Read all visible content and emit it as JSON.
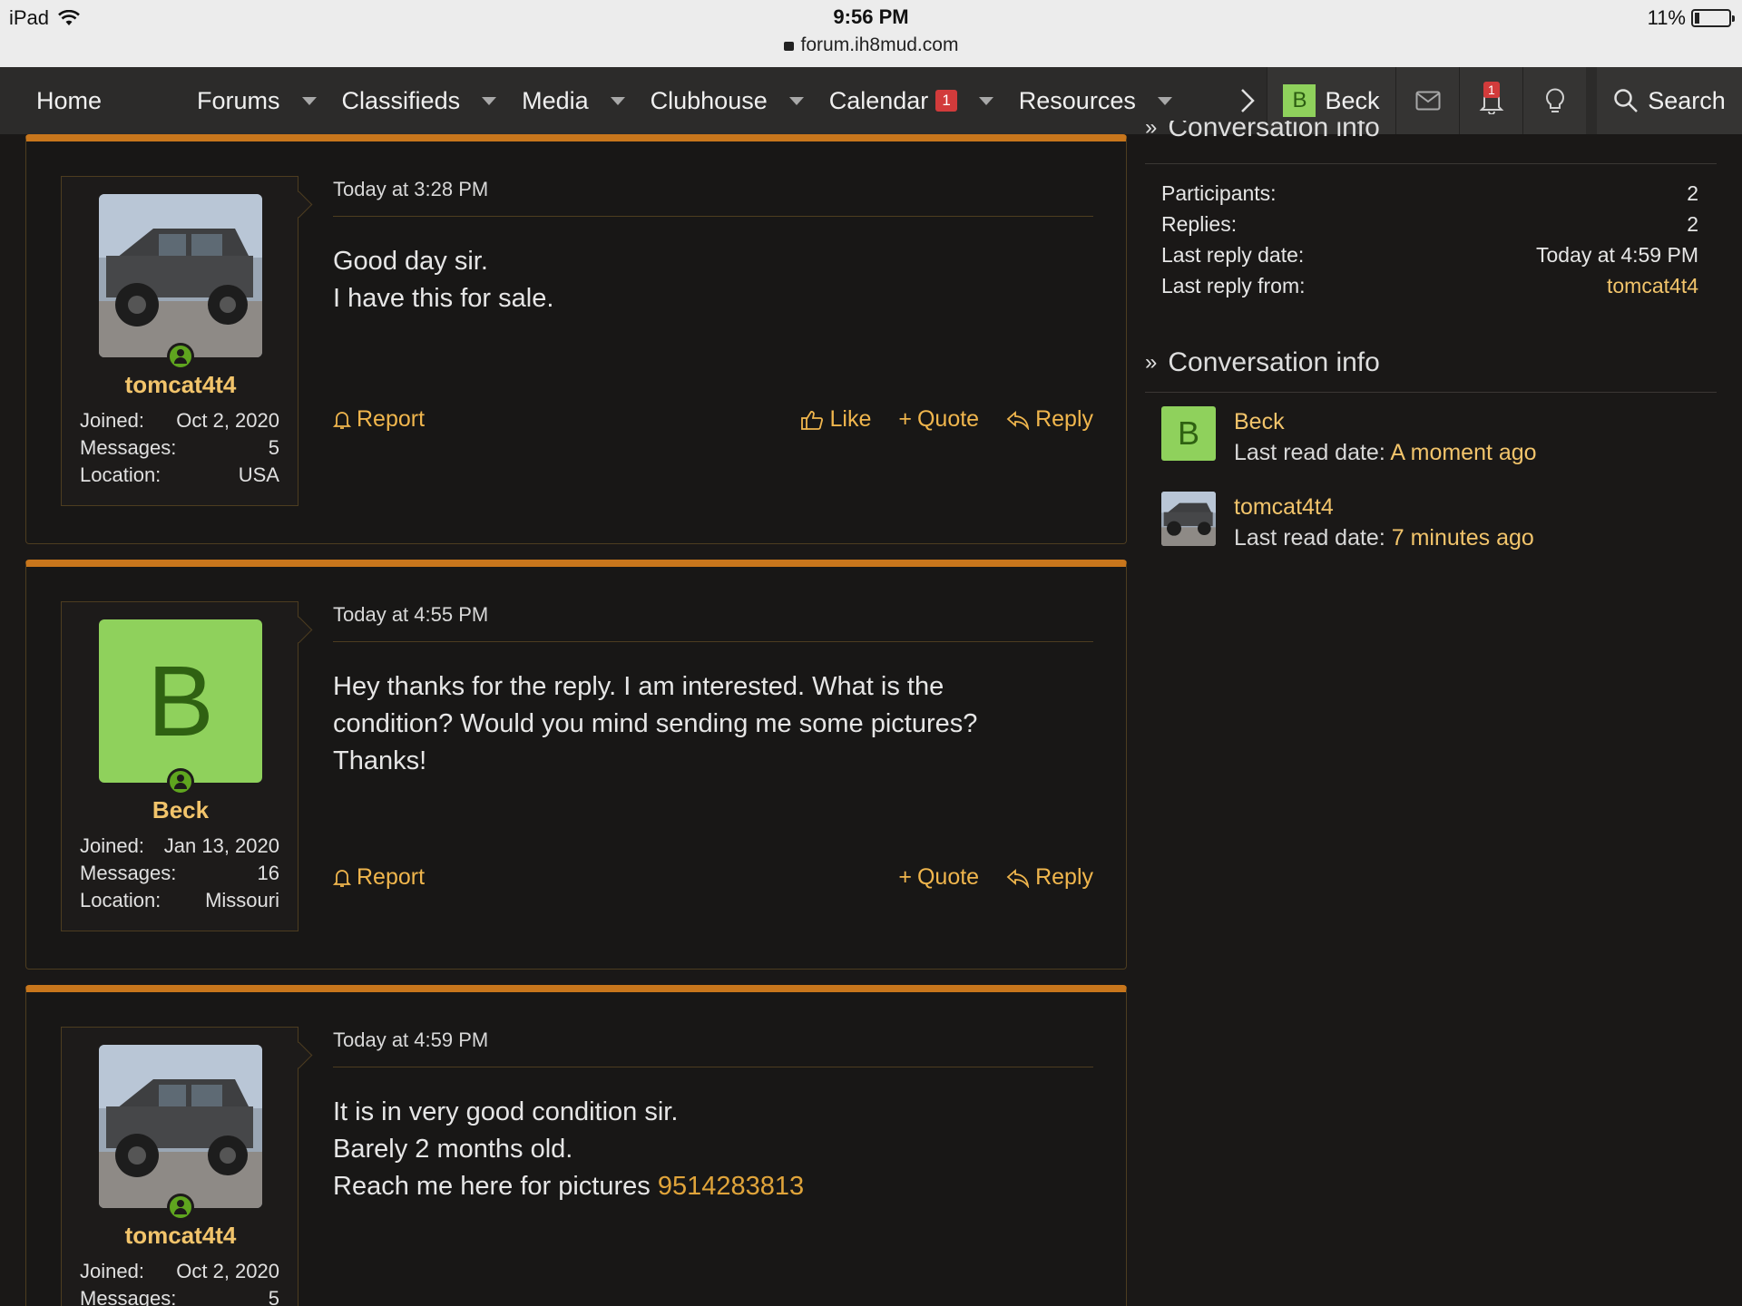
{
  "status_bar": {
    "device": "iPad",
    "time": "9:56 PM",
    "url": "forum.ih8mud.com",
    "battery": "11%"
  },
  "nav": {
    "items": [
      {
        "label": "Home",
        "dropdown": false
      },
      {
        "label": "Forums",
        "dropdown": true
      },
      {
        "label": "Classifieds",
        "dropdown": true
      },
      {
        "label": "Media",
        "dropdown": true
      },
      {
        "label": "Clubhouse",
        "dropdown": true
      },
      {
        "label": "Calendar",
        "dropdown": true,
        "badge": "1"
      },
      {
        "label": "Resources",
        "dropdown": true
      }
    ],
    "user_initial": "B",
    "user_name": "Beck",
    "alerts_badge": "1",
    "search_label": "Search"
  },
  "messages": [
    {
      "user": {
        "name": "tomcat4t4",
        "avatar": "photo",
        "joined_label": "Joined:",
        "joined": "Oct 2, 2020",
        "messages_label": "Messages:",
        "messages": "5",
        "location_label": "Location:",
        "location": "USA"
      },
      "date": "Today at 3:28 PM",
      "lines": [
        "Good day sir.",
        "I have this for sale."
      ],
      "actions": {
        "report": "Report",
        "like": "Like",
        "quote": "Quote",
        "reply": "Reply"
      }
    },
    {
      "user": {
        "name": "Beck",
        "avatar": "letter",
        "initial": "B",
        "joined_label": "Joined:",
        "joined": "Jan 13, 2020",
        "messages_label": "Messages:",
        "messages": "16",
        "location_label": "Location:",
        "location": "Missouri"
      },
      "date": "Today at 4:55 PM",
      "lines": [
        "Hey thanks for the reply. I am interested. What is the",
        "condition? Would you mind sending me some pictures?",
        "Thanks!"
      ],
      "actions": {
        "report": "Report",
        "quote": "Quote",
        "reply": "Reply"
      }
    },
    {
      "user": {
        "name": "tomcat4t4",
        "avatar": "photo",
        "joined_label": "Joined:",
        "joined": "Oct 2, 2020",
        "messages_label": "Messages:",
        "messages": "5"
      },
      "date": "Today at 4:59 PM",
      "lines": [
        "It is in very good condition sir.",
        "Barely 2 months old.",
        "Reach me here for pictures "
      ],
      "phone": "9514283813"
    }
  ],
  "sidebar": {
    "info_title": "Conversation info",
    "participants_label": "Participants:",
    "participants": "2",
    "replies_label": "Replies:",
    "replies": "2",
    "last_reply_date_label": "Last reply date:",
    "last_reply_date": "Today at 4:59 PM",
    "last_reply_from_label": "Last reply from:",
    "last_reply_from": "tomcat4t4",
    "participants_title": "Conversation info",
    "participant_list": [
      {
        "name": "Beck",
        "initial": "B",
        "read_label": "Last read date:",
        "read": "A moment ago"
      },
      {
        "name": "tomcat4t4",
        "read_label": "Last read date:",
        "read": "7 minutes ago"
      }
    ]
  },
  "colors": {
    "accent": "#c8761c",
    "link": "#f2c46b",
    "avatar_green": "#8fd15c",
    "background": "#1a1817"
  }
}
